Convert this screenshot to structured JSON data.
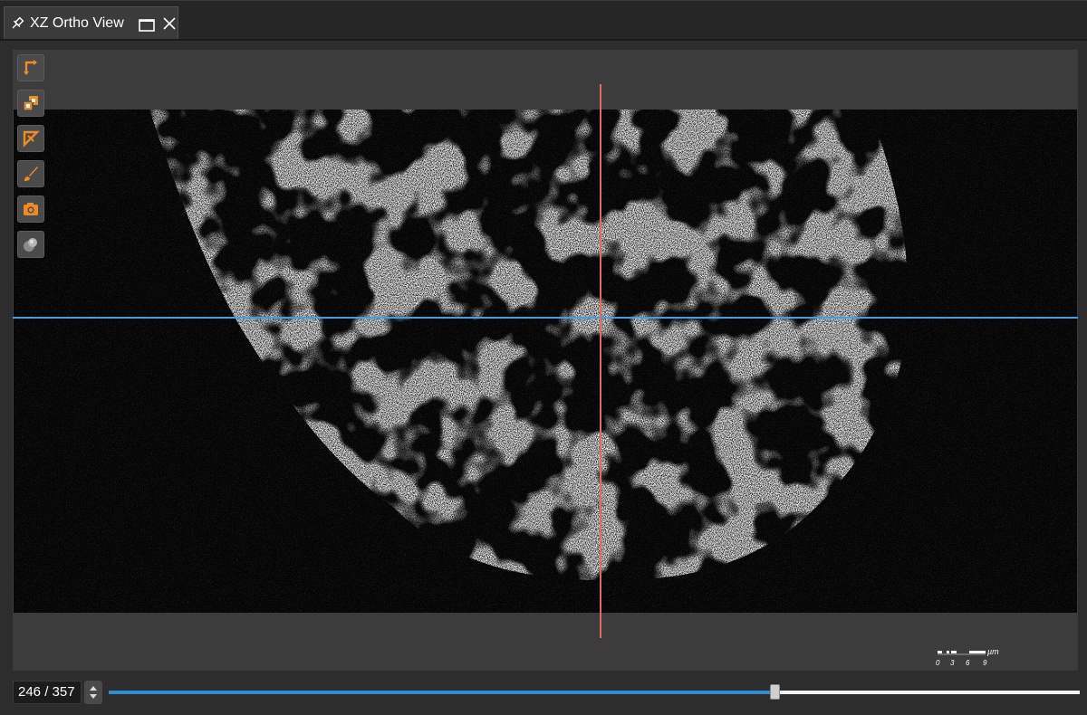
{
  "window": {
    "tab_title": "XZ Ortho View",
    "icons": [
      "pin-icon",
      "maximize-icon",
      "close-icon"
    ]
  },
  "toolbar": {
    "tools": [
      {
        "name": "crosshair-tool",
        "icon": "crosshair-corner-icon"
      },
      {
        "name": "overlay-tool",
        "icon": "overlay-layers-icon"
      },
      {
        "name": "clip-tool",
        "icon": "clip-triangle-icon"
      },
      {
        "name": "paint-tool",
        "icon": "paintbrush-icon"
      },
      {
        "name": "snapshot-tool",
        "icon": "camera-icon"
      },
      {
        "name": "render-tool",
        "icon": "sphere-icon"
      }
    ]
  },
  "view": {
    "crosshair_colors": {
      "horizontal": "#3aa0f0",
      "vertical": "#e36b5a"
    },
    "accent": "#f08a24"
  },
  "scalebar": {
    "unit": "µm",
    "ticks": [
      "0",
      "3",
      "6",
      "9"
    ]
  },
  "navigation": {
    "slice_label": "246 / 357",
    "current_slice": 246,
    "total_slices": 357,
    "slider_fraction": 0.686,
    "slider_color": "#2a8fd6"
  }
}
